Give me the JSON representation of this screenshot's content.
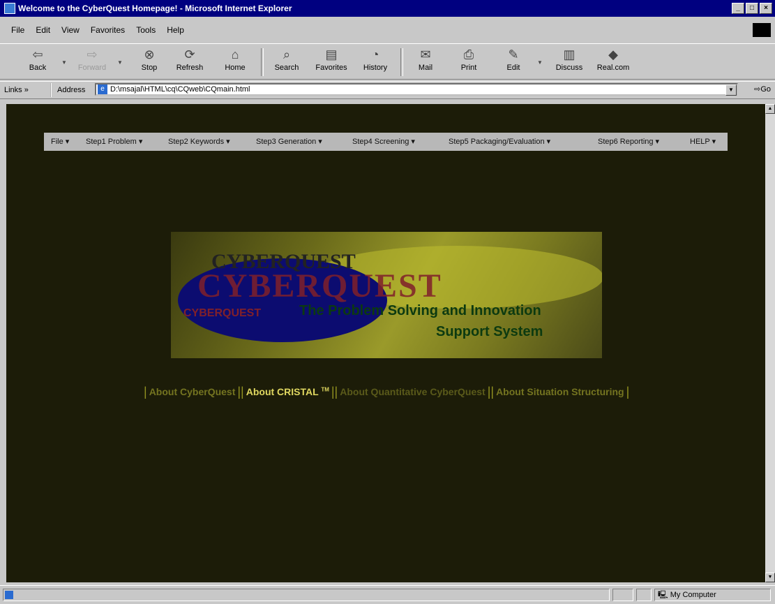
{
  "window": {
    "title": "Welcome to the CyberQuest Homepage! - Microsoft Internet Explorer"
  },
  "menubar": {
    "items": [
      "File",
      "Edit",
      "View",
      "Favorites",
      "Tools",
      "Help"
    ]
  },
  "toolbar": {
    "back": "Back",
    "forward": "Forward",
    "stop": "Stop",
    "refresh": "Refresh",
    "home": "Home",
    "search": "Search",
    "favorites": "Favorites",
    "history": "History",
    "mail": "Mail",
    "print": "Print",
    "edit": "Edit",
    "discuss": "Discuss",
    "realcom": "Real.com"
  },
  "address": {
    "links": "Links",
    "label": "Address",
    "url": "D:\\msajal\\HTML\\cq\\CQweb\\CQmain.html",
    "go": "Go"
  },
  "site_menu": [
    "File",
    "Step1 Problem",
    "Step2 Keywords",
    "Step3 Generation",
    "Step4 Screening",
    "Step5 Packaging/Evaluation",
    "Step6 Reporting",
    "HELP"
  ],
  "banner": {
    "logo": "CYBERQUEST",
    "tagline_1": "The Problem Solving and Innovation",
    "tagline_2": "Support System"
  },
  "nav_links": {
    "about_cyberquest": "About CyberQuest",
    "about_cristal": "About CRISTAL",
    "about_cristal_tm": "TM",
    "about_quantitative": "About Quantitative CyberQuest",
    "about_situation": "About Situation Structuring"
  },
  "status": {
    "zone": "My Computer"
  },
  "colors": {
    "titlebar": "#000080",
    "content_bg": "#1c1c08",
    "link": "#747420",
    "link_active": "#e0d860"
  }
}
